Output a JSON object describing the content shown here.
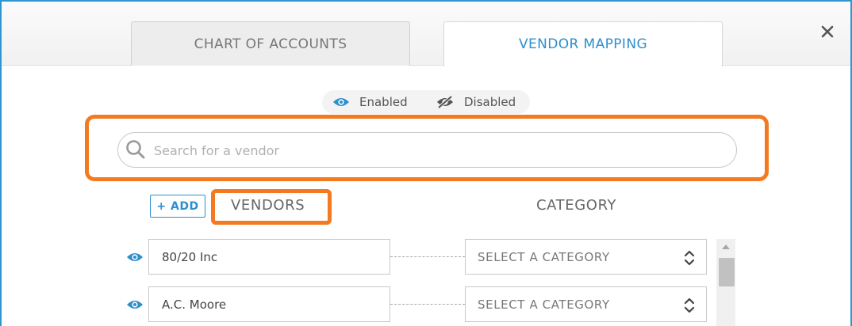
{
  "tabs": [
    {
      "label": "CHART OF ACCOUNTS",
      "active": false
    },
    {
      "label": "VENDOR MAPPING",
      "active": true
    }
  ],
  "close": {
    "glyph": "✕",
    "icon": "close-icon"
  },
  "legend": {
    "enabled_label": "Enabled",
    "disabled_label": "Disabled"
  },
  "search": {
    "placeholder": "Search for a vendor",
    "value": ""
  },
  "add_button": {
    "label": "+ ADD"
  },
  "columns": {
    "vendors": "VENDORS",
    "category": "CATEGORY"
  },
  "rows": [
    {
      "vendor": "80/20 Inc",
      "category": "SELECT A CATEGORY",
      "enabled": true
    },
    {
      "vendor": "A.C. Moore",
      "category": "SELECT A CATEGORY",
      "enabled": true
    }
  ],
  "colors": {
    "accent": "#2d8fcc",
    "frame": "#2f95d3",
    "highlight": "#f37a20"
  }
}
